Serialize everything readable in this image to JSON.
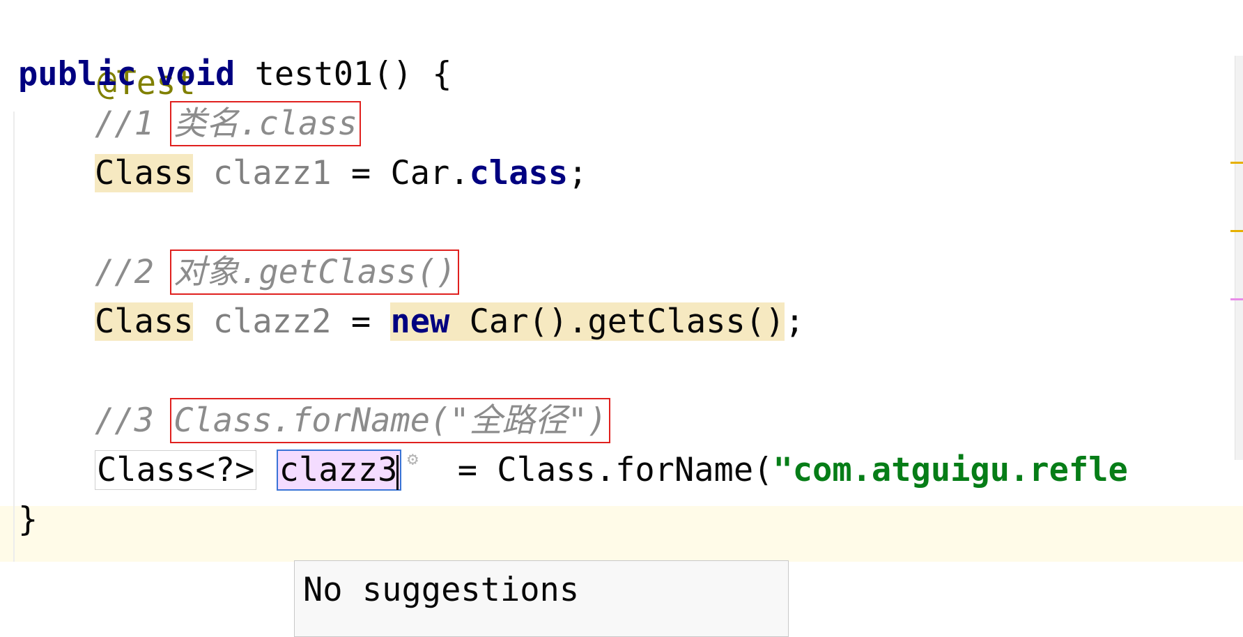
{
  "editor": {
    "annotation": "@Test",
    "method": {
      "modifier": "public",
      "return_type": "void",
      "name": "test01",
      "signature_rest": "() {"
    },
    "comments": [
      {
        "prefix": "//1 ",
        "text": "类名.class"
      },
      {
        "prefix": "//2 ",
        "text": "对象.getClass()"
      },
      {
        "prefix": "//3 ",
        "text": "Class.forName(\"全路径\")"
      }
    ],
    "line1": {
      "type": "Class",
      "var": "clazz1",
      "op": "=",
      "owner": "Car.",
      "kw": "class",
      "end": ";"
    },
    "line2": {
      "type": "Class",
      "var": "clazz2",
      "op": "=",
      "kw": "new",
      "expr": "Car().getClass()",
      "end": ";"
    },
    "line3": {
      "type": "Class<?>",
      "var": "clazz3",
      "op": "=",
      "call": "Class.forName(",
      "string": "\"com.atguigu.refle"
    },
    "closing_brace": "}"
  },
  "popup": {
    "label": "No suggestions"
  },
  "colors": {
    "keyword": "#000080",
    "annotation": "#808000",
    "comment": "#8c8c8c",
    "string": "#067d17",
    "usage_highlight": "#f6e9c1",
    "callout_box": "#e0201e",
    "template_active": "#f4dcff"
  },
  "icons": {
    "template_settings": "gear-icon"
  }
}
